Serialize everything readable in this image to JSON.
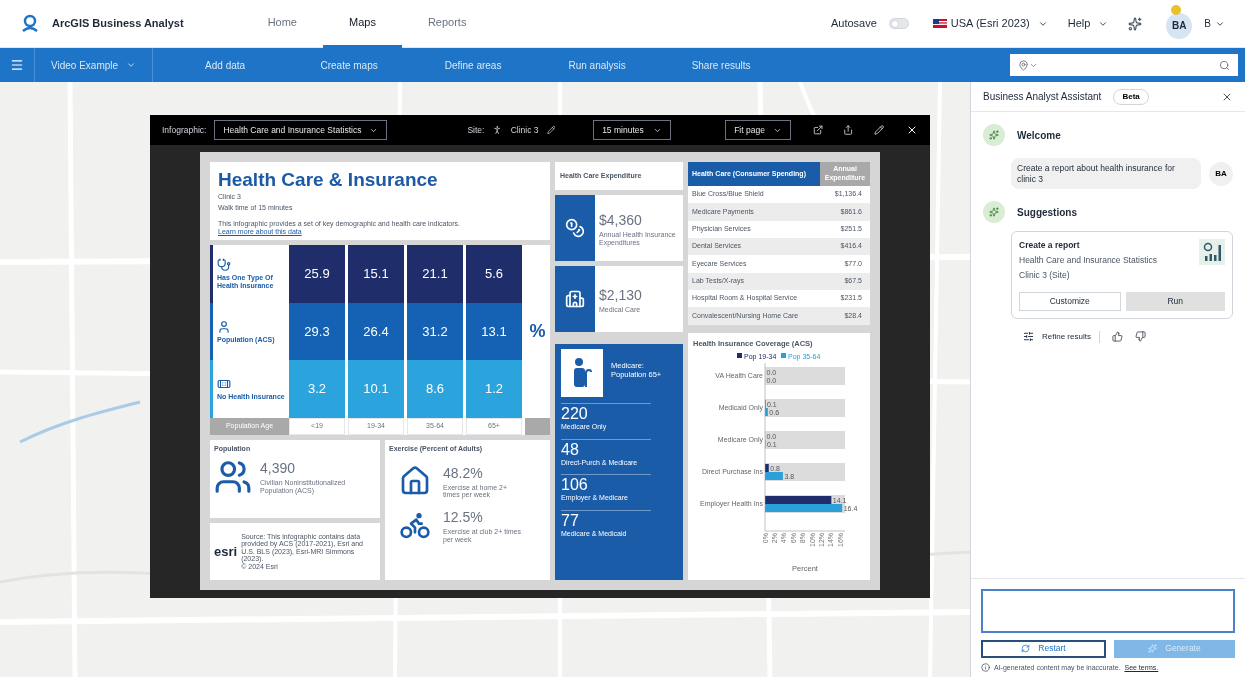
{
  "app": {
    "name": "ArcGIS Business Analyst"
  },
  "nav_tabs": [
    {
      "label": "Home",
      "selected": false
    },
    {
      "label": "Maps",
      "selected": true
    },
    {
      "label": "Reports",
      "selected": false
    }
  ],
  "header_right": {
    "autosave": {
      "label": "Autosave",
      "on": false
    },
    "region": "USA (Esri 2023)",
    "help": "Help",
    "avatar": "BA",
    "user": "B"
  },
  "toolbar": {
    "project": "Video Example",
    "items": [
      "Add data",
      "Create maps",
      "Define areas",
      "Run analysis",
      "Share results"
    ]
  },
  "viewer": {
    "label": "Infographic:",
    "infographic": "Health Care and Insurance Statistics",
    "site_label": "Site:",
    "site": "Clinic 3",
    "travel": "15 minutes",
    "zoom": "Fit page"
  },
  "infographic": {
    "title": "Health Care & Insurance",
    "site": "Clinic 3",
    "subtitle": "Walk time of 15 minutes",
    "description": "This infographic provides a set of key demographic and health care indicators.",
    "link": "Learn more about this data",
    "age_table": {
      "rows": [
        {
          "kind": "stethoscope",
          "label": "Has One Type Of Health Insurance",
          "color": "#1f2d6b",
          "values": [
            "25.9",
            "15.1",
            "21.1",
            "5.6"
          ]
        },
        {
          "kind": "person",
          "label": "Population (ACS)",
          "color": "#1561b3",
          "values": [
            "29.3",
            "26.4",
            "31.2",
            "13.1"
          ]
        },
        {
          "kind": "bandage",
          "label": "No Health Insurance",
          "color": "#2ba3dc",
          "values": [
            "3.2",
            "10.1",
            "8.6",
            "1.2"
          ]
        }
      ],
      "unit": "%",
      "axis_label": "Population Age",
      "ages": [
        "<19",
        "19-34",
        "35-64",
        "65+"
      ]
    },
    "expenditure": {
      "title": "Health Care Expenditure",
      "items": [
        {
          "kind": "coins",
          "value": "$4,360",
          "label": "Annual Health Insurance Expenditures"
        },
        {
          "kind": "hospital",
          "value": "$2,130",
          "label": "Medical Care"
        }
      ]
    },
    "spending_table": {
      "columns": [
        "Health Care (Consumer Spending)",
        "Annual Expenditure"
      ],
      "rows": [
        [
          "Blue Cross/Blue Shield",
          "$1,136.4"
        ],
        [
          "Medicare Payments",
          "$861.6"
        ],
        [
          "Physician Services",
          "$251.5"
        ],
        [
          "Dental Services",
          "$416.4"
        ],
        [
          "Eyecare Services",
          "$77.0"
        ],
        [
          "Lab Tests/X-rays",
          "$67.5"
        ],
        [
          "Hospital Room & Hospital Service",
          "$231.5"
        ],
        [
          "Convalescent/Nursing Home Care",
          "$28.4"
        ]
      ]
    },
    "medicare": {
      "title": "Medicare: Population 65+",
      "stats": [
        {
          "value": "220",
          "label": "Medicare Only"
        },
        {
          "value": "48",
          "label": "Direct-Purch & Medicare"
        },
        {
          "value": "106",
          "label": "Employer & Medicare"
        },
        {
          "value": "77",
          "label": "Medicare & Medicaid"
        }
      ]
    },
    "coverage": {
      "chart_data": {
        "type": "bar",
        "orientation": "horizontal",
        "title": "Health Insurance Coverage (ACS)",
        "xlabel": "Percent",
        "categories": [
          "VA Health Care",
          "Medicaid Only",
          "Medicare Only",
          "Direct Purchase Ins",
          "Employer Health Ins"
        ],
        "series": [
          {
            "name": "Pop 19-34",
            "color": "#1f2d6b",
            "values": [
              0.0,
              0.1,
              0.0,
              0.8,
              14.1
            ],
            "value_labels": [
              "0.0",
              "0.1",
              "0.0",
              "0.8",
              "14.1"
            ]
          },
          {
            "name": "Pop 35-64",
            "color": "#2a9fd8",
            "values": [
              0.0,
              0.6,
              0.1,
              3.8,
              16.4
            ],
            "value_labels": [
              "0.0",
              "0.6",
              "0.1",
              "3.8",
              "16.4"
            ]
          }
        ],
        "xlim": [
          0,
          17
        ],
        "xticks": [
          {
            "value": 0,
            "label": "0%"
          },
          {
            "value": 2,
            "label": "2%"
          },
          {
            "value": 4,
            "label": "4%"
          },
          {
            "value": 6,
            "label": "6%"
          },
          {
            "value": 8,
            "label": "8%"
          },
          {
            "value": 10,
            "label": "10%"
          },
          {
            "value": 12,
            "label": "12%"
          },
          {
            "value": 14,
            "label": "14%"
          },
          {
            "value": 16,
            "label": "16%"
          }
        ],
        "data_labels": true,
        "legend": true,
        "grid": true
      }
    },
    "population": {
      "title": "Population",
      "value": "4,390",
      "label": "Civilian Noninstitutionalized Population (ACS)"
    },
    "exercise": {
      "title": "Exercise (Percent of Adults)",
      "items": [
        {
          "kind": "house",
          "value": "48.2%",
          "label": "Exercise at home 2+ times per week"
        },
        {
          "kind": "bicycle",
          "value": "12.5%",
          "label": "Exercise at club 2+ times per week"
        }
      ]
    },
    "footer": {
      "logo": "esri",
      "source": "Source: This infographic contains data provided by ACS (2017-2021), Esri and U.S. BLS (2023), Esri-MRI Simmons (2023).",
      "copyright": "© 2024 Esri"
    }
  },
  "assistant": {
    "title": "Business Analyst Assistant",
    "badge": "Beta",
    "welcome": "Welcome",
    "user_message": {
      "text": "Create a report about health insurance for clinic 3",
      "avatar": "BA"
    },
    "suggestions_title": "Suggestions",
    "suggestion": {
      "title": "Create a report",
      "name": "Health Care and Insurance Statistics",
      "site": "Clinic 3 (Site)",
      "buttons": [
        "Customize",
        "Run"
      ]
    },
    "refine": "Refine results",
    "restart": "Restart",
    "generate": {
      "label": "Generate",
      "disabled": true
    },
    "disclaimer": "AI-generated content may be inaccurate.",
    "terms": "See terms."
  }
}
